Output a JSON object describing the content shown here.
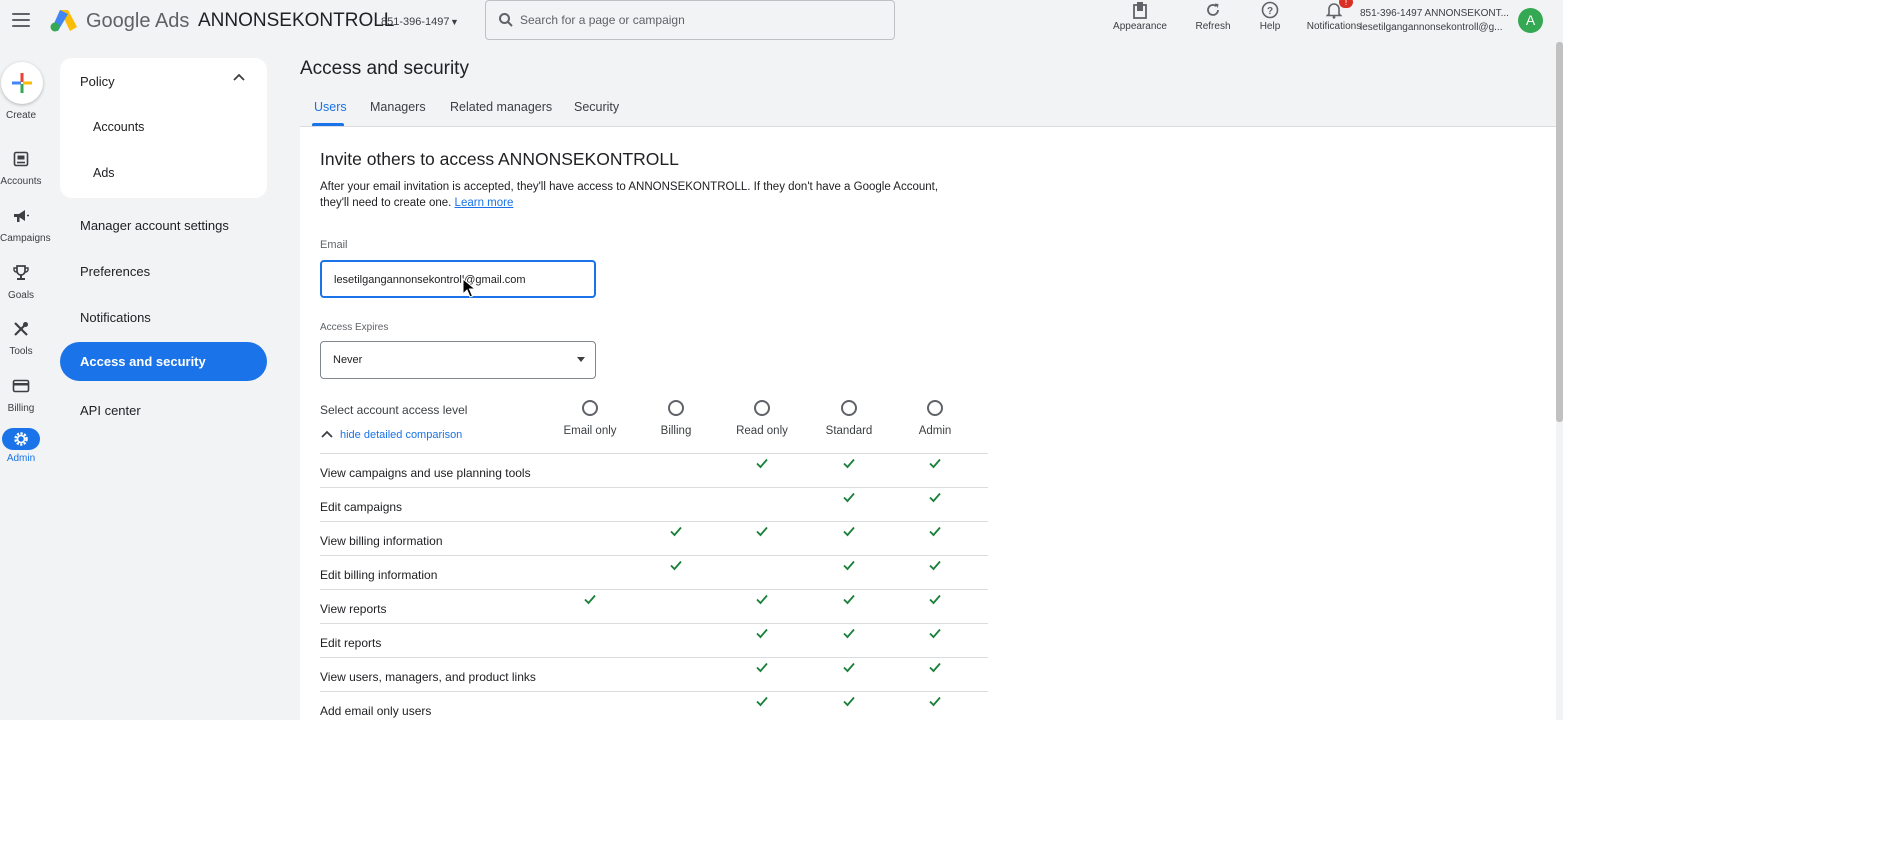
{
  "header": {
    "brand_google": "Google",
    "brand_ads": "Ads",
    "account_name": "ANNONSEKONTROLL",
    "account_id": "851-396-1497",
    "search_placeholder": "Search for a page or campaign",
    "actions": [
      {
        "label": "Appearance",
        "icon": "appearance-icon"
      },
      {
        "label": "Refresh",
        "icon": "refresh-icon"
      },
      {
        "label": "Help",
        "icon": "help-icon"
      },
      {
        "label": "Notifications",
        "icon": "notifications-icon",
        "badge": "!"
      }
    ],
    "user_account_line": "851-396-1497 ANNONSEKONT...",
    "user_email_line": "lesetilgangannonsekontroll@g...",
    "avatar_letter": "A"
  },
  "rail": {
    "create": "Create",
    "items": [
      {
        "label": "Accounts",
        "icon": "accounts-icon"
      },
      {
        "label": "Campaigns",
        "icon": "campaigns-icon"
      },
      {
        "label": "Goals",
        "icon": "goals-icon"
      },
      {
        "label": "Tools",
        "icon": "tools-icon"
      },
      {
        "label": "Billing",
        "icon": "billing-icon"
      },
      {
        "label": "Admin",
        "icon": "admin-icon",
        "active": true
      }
    ]
  },
  "nav": {
    "policy": "Policy",
    "policy_children": [
      "Accounts",
      "Ads"
    ],
    "items": [
      "Manager account settings",
      "Preferences",
      "Notifications",
      "Access and security",
      "API center"
    ],
    "active": "Access and security"
  },
  "main": {
    "title": "Access and security",
    "tabs": [
      "Users",
      "Managers",
      "Related managers",
      "Security"
    ],
    "active_tab": "Users",
    "invite_title": "Invite others to access ANNONSEKONTROLL",
    "invite_desc": "After your email invitation is accepted, they'll have access to ANNONSEKONTROLL. If they don't have a Google Account, they'll need to create one.",
    "learn_more": "Learn more",
    "email_label": "Email",
    "email_value": "lesetilgangannonsekontroll@gmail.com",
    "expires_label": "Access Expires",
    "expires_value": "Never",
    "level_label": "Select account access level",
    "hide_comparison": "hide detailed comparison",
    "levels": [
      "Email only",
      "Billing",
      "Read only",
      "Standard",
      "Admin"
    ],
    "permissions": [
      {
        "label": "View campaigns and use planning tools",
        "checks": [
          false,
          false,
          true,
          true,
          true
        ]
      },
      {
        "label": "Edit campaigns",
        "checks": [
          false,
          false,
          false,
          true,
          true
        ]
      },
      {
        "label": "View billing information",
        "checks": [
          false,
          true,
          true,
          true,
          true
        ]
      },
      {
        "label": "Edit billing information",
        "checks": [
          false,
          true,
          false,
          true,
          true
        ]
      },
      {
        "label": "View reports",
        "checks": [
          true,
          false,
          true,
          true,
          true
        ]
      },
      {
        "label": "Edit reports",
        "checks": [
          false,
          false,
          true,
          true,
          true
        ]
      },
      {
        "label": "View users, managers, and product links",
        "checks": [
          false,
          false,
          true,
          true,
          true
        ]
      },
      {
        "label": "Add email only users",
        "checks": [
          false,
          false,
          true,
          true,
          true
        ]
      }
    ]
  },
  "colors": {
    "accent": "#1a73e8",
    "check": "#188038",
    "background": "#f1f3f4"
  }
}
